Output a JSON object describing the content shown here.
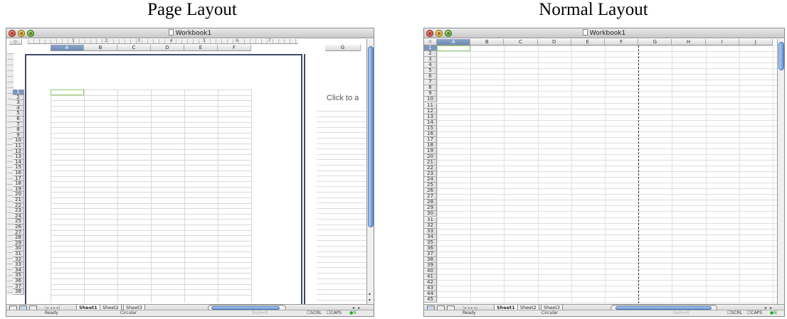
{
  "captions": {
    "left": "Page Layout",
    "right": "Normal Layout"
  },
  "window_title": "Workbook1",
  "left": {
    "columns": [
      "A",
      "B",
      "C",
      "D",
      "E",
      "F"
    ],
    "extra_column": "G",
    "rows": [
      "1",
      "2",
      "3",
      "4",
      "5",
      "6",
      "7",
      "8",
      "9",
      "10",
      "11",
      "12",
      "13",
      "14",
      "15",
      "16",
      "17",
      "18",
      "19",
      "20",
      "21",
      "22",
      "23",
      "24",
      "25",
      "26",
      "27",
      "28",
      "29",
      "30",
      "31",
      "32",
      "33",
      "34",
      "35",
      "36",
      "37",
      "38"
    ],
    "ruler_numbers": [
      "1",
      "2",
      "3",
      "4",
      "5",
      "6",
      "7"
    ],
    "header_prompt": "Click to a"
  },
  "right": {
    "columns": [
      "A",
      "B",
      "C",
      "D",
      "E",
      "F",
      "G",
      "H",
      "I",
      "J"
    ],
    "rows": [
      "1",
      "2",
      "3",
      "4",
      "5",
      "6",
      "7",
      "8",
      "9",
      "10",
      "11",
      "12",
      "13",
      "14",
      "15",
      "16",
      "17",
      "18",
      "19",
      "20",
      "21",
      "22",
      "23",
      "24",
      "25",
      "26",
      "27",
      "28",
      "29",
      "30",
      "31",
      "32",
      "33",
      "34",
      "35",
      "36",
      "37",
      "38",
      "39",
      "40",
      "41",
      "42",
      "43",
      "44",
      "45"
    ]
  },
  "sheet_tabs": [
    "Sheet1",
    "Sheet2",
    "Sheet3"
  ],
  "status": {
    "ready": "Ready",
    "circular": "Circular",
    "sum": "Sum=0",
    "scrl": "SCRL",
    "caps": "CAPS",
    "num": "N"
  },
  "colors": {
    "selection": "#8fcf6e",
    "header_selected": "#6d89b4",
    "thumb": "#5f8fd2"
  }
}
